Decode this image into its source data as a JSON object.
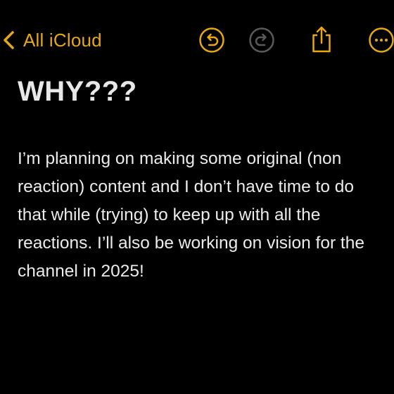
{
  "toolbar": {
    "back_label": "All iCloud",
    "accent_color": "#e6a817",
    "disabled_color": "#5a5a5a",
    "icons": [
      "chevron-left-icon",
      "undo-icon",
      "redo-icon",
      "share-icon",
      "more-icon"
    ]
  },
  "note": {
    "title": "WHY???",
    "body": "I’m planning on making some original (non reaction) content and I don’t have time to do that while (trying) to keep up with all the reactions. I’ll also be working on vision for the channel in 2025!"
  }
}
